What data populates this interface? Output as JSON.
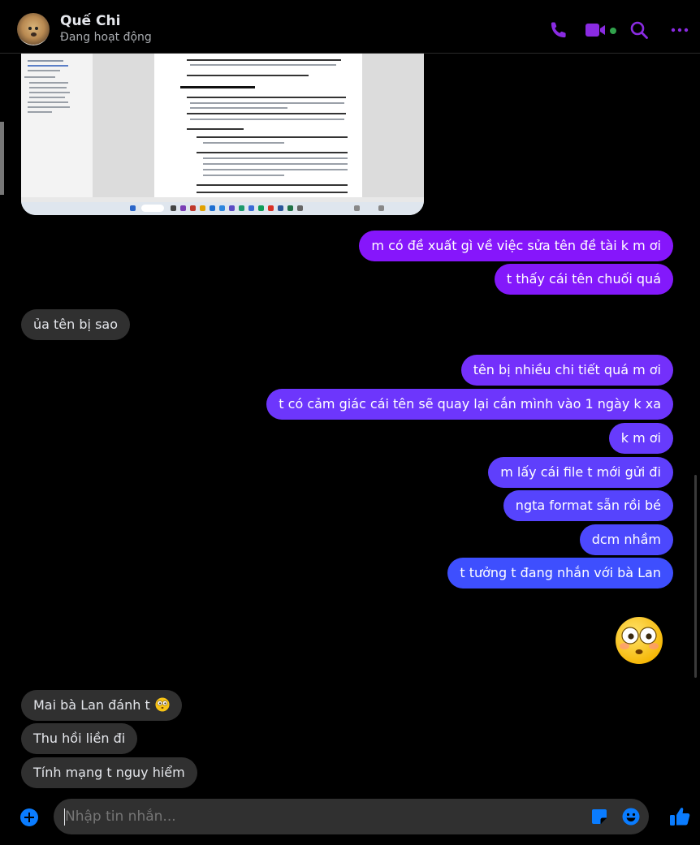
{
  "header": {
    "name": "Quế Chi",
    "status": "Đang hoạt động"
  },
  "colors": {
    "accent": "#8a2be2",
    "outgoing_top": "#8a1bff",
    "outgoing_bottom": "#2d53ff",
    "incoming": "#303030",
    "online": "#31a24c"
  },
  "icons": [
    "phone-icon",
    "video-icon",
    "search-icon",
    "more-icon",
    "plus-icon",
    "sticker-icon",
    "emoji-icon",
    "thumbs-up-icon"
  ],
  "messages": [
    {
      "dir": "out",
      "text": "m có đề xuất gì về việc sửa tên đề tài k m ơi",
      "color": "#8616fb"
    },
    {
      "dir": "out",
      "text": "t thấy cái tên chuối quá",
      "color": "#8319fb"
    },
    {
      "dir": "in",
      "text": "ủa tên bị sao"
    },
    {
      "dir": "out",
      "text": "tên bị nhiều chi tiết quá m ơi",
      "color": "#7430fb"
    },
    {
      "dir": "out",
      "text": "t có cảm giác cái tên sẽ quay lại cắn mình vào 1 ngày k xa",
      "color": "#6d36fc"
    },
    {
      "dir": "out",
      "text": "k m ơi",
      "color": "#673bfc"
    },
    {
      "dir": "out",
      "text": "m lấy cái file t mới gửi đi",
      "color": "#5f3ffc"
    },
    {
      "dir": "out",
      "text": "ngta format sẵn rồi bé",
      "color": "#5644fd"
    },
    {
      "dir": "out",
      "text": "dcm nhầm",
      "color": "#4c48fd"
    },
    {
      "dir": "out",
      "text": "t tưởng t đang nhắn với bà Lan",
      "color": "#3e4ffe"
    },
    {
      "dir": "in",
      "text": "Mai bà Lan đánh t",
      "emoji": "flushed-face"
    },
    {
      "dir": "in",
      "text": "Thu hồi liền đi"
    },
    {
      "dir": "in",
      "text": "Tính mạng t nguy hiểm"
    }
  ],
  "big_emoji": "flushed-face",
  "composer": {
    "placeholder": "Nhập tin nhắn..."
  }
}
